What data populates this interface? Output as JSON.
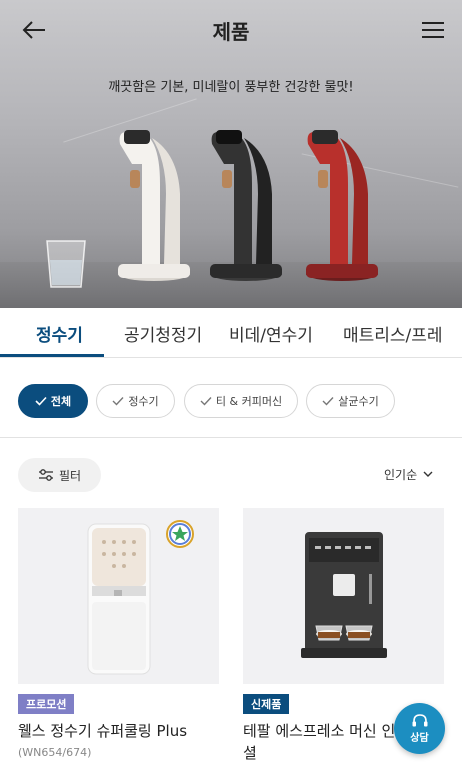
{
  "header": {
    "title": "제품",
    "back_icon": "arrow-left-icon",
    "menu_icon": "hamburger-menu-icon"
  },
  "hero": {
    "tagline": "깨끗함은 기본, 미네랄이 풍부한 건강한 물맛!"
  },
  "tabs": [
    {
      "label": "정수기",
      "active": true
    },
    {
      "label": "공기청정기",
      "active": false
    },
    {
      "label": "비데/연수기",
      "active": false
    },
    {
      "label": "매트리스/프레",
      "active": false
    }
  ],
  "chips": [
    {
      "label": "전체",
      "active": true
    },
    {
      "label": "정수기",
      "active": false
    },
    {
      "label": "티 & 커피머신",
      "active": false
    },
    {
      "label": "살균수기",
      "active": false
    }
  ],
  "toolbar": {
    "filter_label": "필터",
    "sort_label": "인기순"
  },
  "products": [
    {
      "badge": "프로모션",
      "name": "웰스 정수기 슈퍼쿨링 Plus",
      "model": "(WN654/674)"
    },
    {
      "badge": "신제품",
      "name": "테팔 에스프레소 머신 인 에센셜",
      "model": ""
    }
  ],
  "consult": {
    "label": "상담"
  },
  "colors": {
    "accent": "#0b4d7e",
    "promo_badge": "#7f7fc6",
    "consult_button": "#1c8ec1"
  }
}
